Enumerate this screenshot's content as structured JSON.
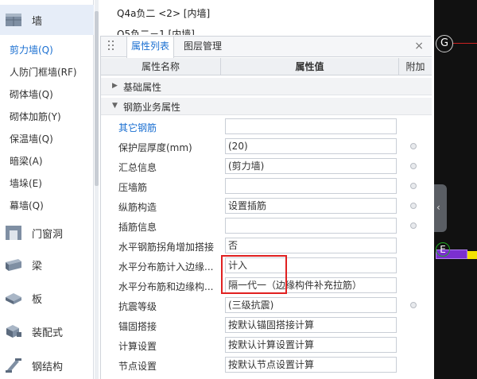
{
  "nav": {
    "categories": [
      {
        "label": "墙",
        "icon": "wall-icon"
      },
      {
        "label": "门窗洞",
        "icon": "door-window-icon"
      },
      {
        "label": "梁",
        "icon": "beam-icon"
      },
      {
        "label": "板",
        "icon": "slab-icon"
      },
      {
        "label": "装配式",
        "icon": "prefab-icon"
      },
      {
        "label": "钢结构",
        "icon": "steel-structure-icon"
      }
    ],
    "wall_items": [
      {
        "label": "剪力墙(Q)",
        "active": true
      },
      {
        "label": "人防门框墙(RF)"
      },
      {
        "label": "砌体墙(Q)"
      },
      {
        "label": "砌体加筋(Y)"
      },
      {
        "label": "保温墙(Q)"
      },
      {
        "label": "暗梁(A)"
      },
      {
        "label": "墙垛(E)"
      },
      {
        "label": "幕墙(Q)"
      }
    ]
  },
  "toplist": {
    "rows": [
      "Q4a负二 <2> [内墙]",
      "Q5负二－1 [内墙]"
    ]
  },
  "panel": {
    "tabs": [
      "属性列表",
      "图层管理"
    ],
    "close": "×",
    "columns": {
      "name": "属性名称",
      "value": "属性值",
      "add": "附加"
    },
    "groups": [
      "基础属性",
      "钢筋业务属性"
    ],
    "rows": [
      {
        "name": "其它钢筋",
        "value": "",
        "radio": false,
        "link": true
      },
      {
        "name": "保护层厚度(mm)",
        "value": "(20)",
        "radio": true
      },
      {
        "name": "汇总信息",
        "value": "(剪力墙)",
        "radio": true
      },
      {
        "name": "压墙筋",
        "value": "",
        "radio": true
      },
      {
        "name": "纵筋构造",
        "value": "设置插筋",
        "radio": true
      },
      {
        "name": "插筋信息",
        "value": "",
        "radio": true
      },
      {
        "name": "水平钢筋拐角增加搭接",
        "value": "否",
        "radio": false
      },
      {
        "name": "水平分布筋计入边缘...",
        "value": "计入",
        "radio": false
      },
      {
        "name": "水平分布筋和边缘构...",
        "value": "隔一代一（边缘构件补充拉筋）",
        "radio": false
      },
      {
        "name": "抗震等级",
        "value": "(三级抗震)",
        "radio": true
      },
      {
        "name": "锚固搭接",
        "value": "按默认锚固搭接计算",
        "radio": false
      },
      {
        "name": "计算设置",
        "value": "按默认计算设置计算",
        "radio": false
      },
      {
        "name": "节点设置",
        "value": "按默认节点设置计算",
        "radio": false
      }
    ]
  },
  "canvas": {
    "axis_g": "G",
    "axis_e": "E",
    "collapse": "‹"
  },
  "colors": {
    "accent": "#1a6fd1",
    "highlight": "#e02020",
    "canvas_bg": "#111111"
  }
}
